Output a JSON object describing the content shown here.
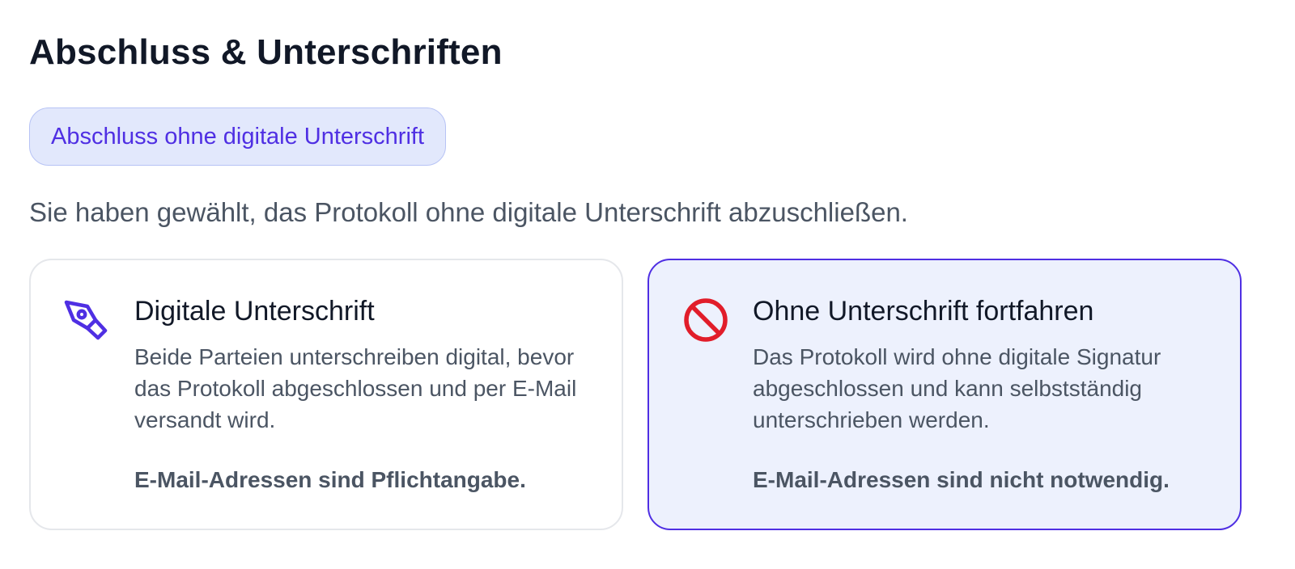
{
  "page": {
    "title": "Abschluss & Unterschriften"
  },
  "mode_chip": {
    "label": "Abschluss ohne digitale Unterschrift"
  },
  "selection_text": "Sie haben gewählt, das Protokoll ohne digitale Unterschrift abzuschließen.",
  "options": [
    {
      "icon": "pen-nib-icon",
      "title": "Digitale Unterschrift",
      "description": "Beide Parteien unterschreiben digital, bevor das Protokoll abgeschlossen und per E-Mail versandt wird.",
      "note": "E-Mail-Adressen sind Pflichtangabe.",
      "selected": false
    },
    {
      "icon": "no-entry-icon",
      "title": "Ohne Unterschrift fortfahren",
      "description": "Das Protokoll wird ohne digitale Signatur abgeschlossen und kann selbstständig unterschrieben werden.",
      "note": "E-Mail-Adressen sind nicht notwendig.",
      "selected": true
    }
  ],
  "colors": {
    "accent": "#4f2fe3",
    "chip_background": "#e2e8fc",
    "selected_card_background": "#edf1fd",
    "no_entry_red": "#e11d2a",
    "text_primary": "#111827",
    "text_secondary": "#4b5563"
  }
}
